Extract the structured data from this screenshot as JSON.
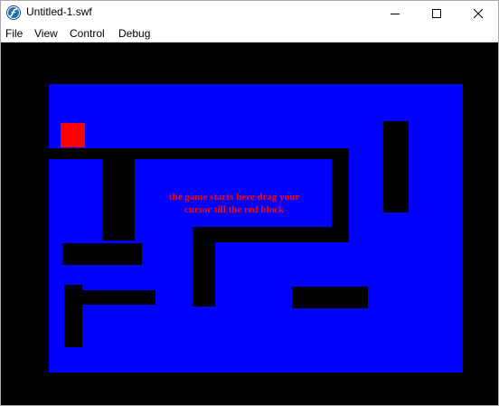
{
  "window": {
    "title": "Untitled-1.swf",
    "app_icon": "flash-player-icon",
    "controls": {
      "minimize_icon": "minimize-icon",
      "maximize_icon": "maximize-icon",
      "close_icon": "close-icon"
    }
  },
  "menu": {
    "items": [
      {
        "label": "File"
      },
      {
        "label": "View"
      },
      {
        "label": "Control"
      },
      {
        "label": "Debug"
      }
    ]
  },
  "game": {
    "instructions_line1": "the game starts here drag your",
    "instructions_line2": "cursor till the red block",
    "colors": {
      "background": "#000000",
      "field": "#0000ff",
      "walls": "#000000",
      "target_block": "#ff0000",
      "instruction_text": "#ff0000"
    }
  }
}
